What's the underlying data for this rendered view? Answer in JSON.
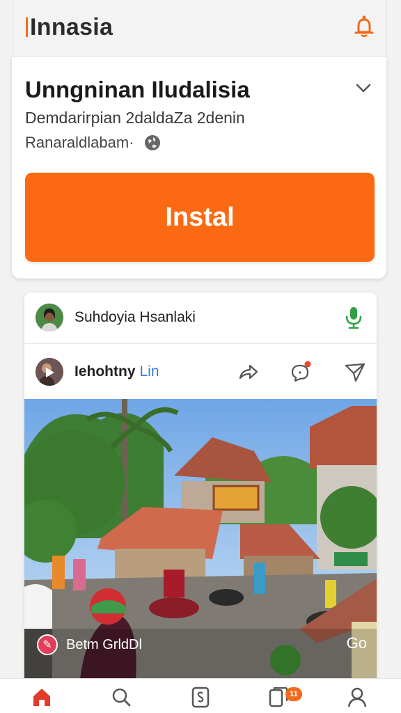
{
  "header": {
    "brand": "Innasia",
    "bell_icon": "bell-icon",
    "accent": "#f26a1b"
  },
  "app": {
    "title": "Unngninan Iludalisia",
    "developer": "Demdarirpian 2daldaZa 2denin",
    "meta": "Ranaraldlabam·",
    "install_label": "Instal",
    "install_color": "#fb6a12"
  },
  "post": {
    "author1": "Suhdoyia Hsanlaki",
    "author2": "Iehohtny",
    "author2_tag": "Lin",
    "mic_color": "#2ea043",
    "overlay_label": "Betm GrldDl",
    "overlay_right": "Go"
  },
  "nav": {
    "items": [
      "home-icon",
      "search-icon",
      "apps-icon",
      "library-icon",
      "profile-icon"
    ],
    "badge": "11"
  }
}
